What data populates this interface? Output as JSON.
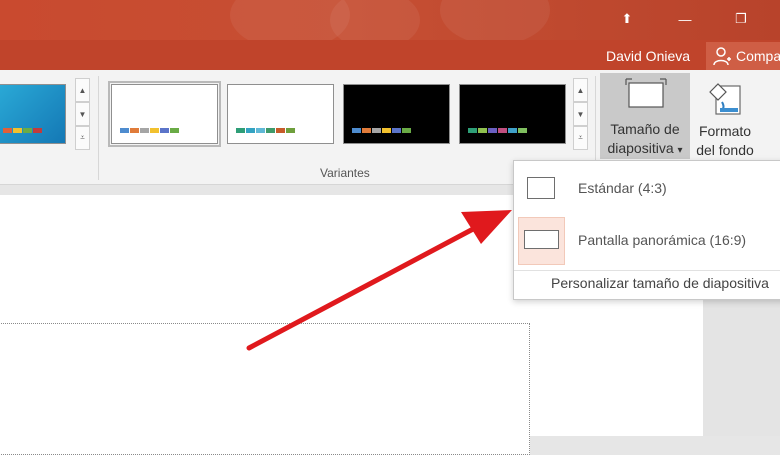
{
  "window": {
    "controls": {
      "ribbon_display": "⬆",
      "minimize": "—",
      "restore": "❐"
    }
  },
  "account": {
    "user_name": "David Onieva",
    "share_label": "Compa"
  },
  "ribbon": {
    "variants_group_label": "Variantes",
    "variants": [
      {
        "background": "#ffffff",
        "selected": true,
        "swatches": [
          "#4e8ccf",
          "#e07b3a",
          "#a5a5a5",
          "#f2c12e",
          "#5b74c9",
          "#6aab46"
        ]
      },
      {
        "background": "#ffffff",
        "selected": false,
        "swatches": [
          "#2e9e77",
          "#33a3c2",
          "#5fb8d6",
          "#3f9a6a",
          "#c75b2a",
          "#6e9f3c"
        ]
      },
      {
        "background": "#000000",
        "selected": false,
        "swatches": [
          "#4e8ccf",
          "#e07b3a",
          "#a5a5a5",
          "#f2c12e",
          "#5b74c9",
          "#6aab46"
        ]
      },
      {
        "background": "#000000",
        "selected": false,
        "swatches": [
          "#2e9e77",
          "#8fc04f",
          "#6a5fc1",
          "#c04f7f",
          "#3fa0c8",
          "#7fbf5f"
        ]
      }
    ],
    "slide_size_button": {
      "line1": "Tamaño de",
      "line2": "diapositiva",
      "caret": "▾"
    },
    "format_background_button": {
      "line1": "Formato",
      "line2": "del fondo"
    }
  },
  "dropdown": {
    "items": [
      {
        "label": "Estándar (4:3)"
      },
      {
        "label": "Pantalla panorámica (16:9)"
      }
    ],
    "custom_label": "Personalizar tamaño de diapositiva"
  },
  "colors": {
    "title_bar": "#c94a2f",
    "annotation_arrow": "#e0191d"
  }
}
